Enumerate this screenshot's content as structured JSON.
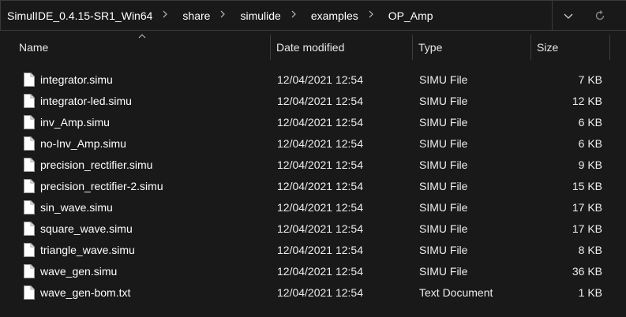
{
  "address": {
    "crumbs": [
      "SimulIDE_0.4.15-SR1_Win64",
      "share",
      "simulide",
      "examples",
      "OP_Amp"
    ]
  },
  "columns": {
    "name": "Name",
    "date": "Date modified",
    "type": "Type",
    "size": "Size"
  },
  "files": [
    {
      "name": "integrator.simu",
      "date": "12/04/2021 12:54",
      "type": "SIMU File",
      "size": "7 KB"
    },
    {
      "name": "integrator-led.simu",
      "date": "12/04/2021 12:54",
      "type": "SIMU File",
      "size": "12 KB"
    },
    {
      "name": "inv_Amp.simu",
      "date": "12/04/2021 12:54",
      "type": "SIMU File",
      "size": "6 KB"
    },
    {
      "name": "no-Inv_Amp.simu",
      "date": "12/04/2021 12:54",
      "type": "SIMU File",
      "size": "6 KB"
    },
    {
      "name": "precision_rectifier.simu",
      "date": "12/04/2021 12:54",
      "type": "SIMU File",
      "size": "9 KB"
    },
    {
      "name": "precision_rectifier-2.simu",
      "date": "12/04/2021 12:54",
      "type": "SIMU File",
      "size": "15 KB"
    },
    {
      "name": "sin_wave.simu",
      "date": "12/04/2021 12:54",
      "type": "SIMU File",
      "size": "17 KB"
    },
    {
      "name": "square_wave.simu",
      "date": "12/04/2021 12:54",
      "type": "SIMU File",
      "size": "17 KB"
    },
    {
      "name": "triangle_wave.simu",
      "date": "12/04/2021 12:54",
      "type": "SIMU File",
      "size": "8 KB"
    },
    {
      "name": "wave_gen.simu",
      "date": "12/04/2021 12:54",
      "type": "SIMU File",
      "size": "36 KB"
    },
    {
      "name": "wave_gen-bom.txt",
      "date": "12/04/2021 12:54",
      "type": "Text Document",
      "size": "1 KB"
    }
  ],
  "icons": {
    "file": "document-icon",
    "separator": "chevron-right-icon",
    "dropdown": "chevron-down-icon",
    "refresh": "refresh-icon",
    "sort": "sort-up-icon"
  },
  "colors": {
    "background": "#191919",
    "text": "#ffffff",
    "border": "#3a3a3a"
  }
}
